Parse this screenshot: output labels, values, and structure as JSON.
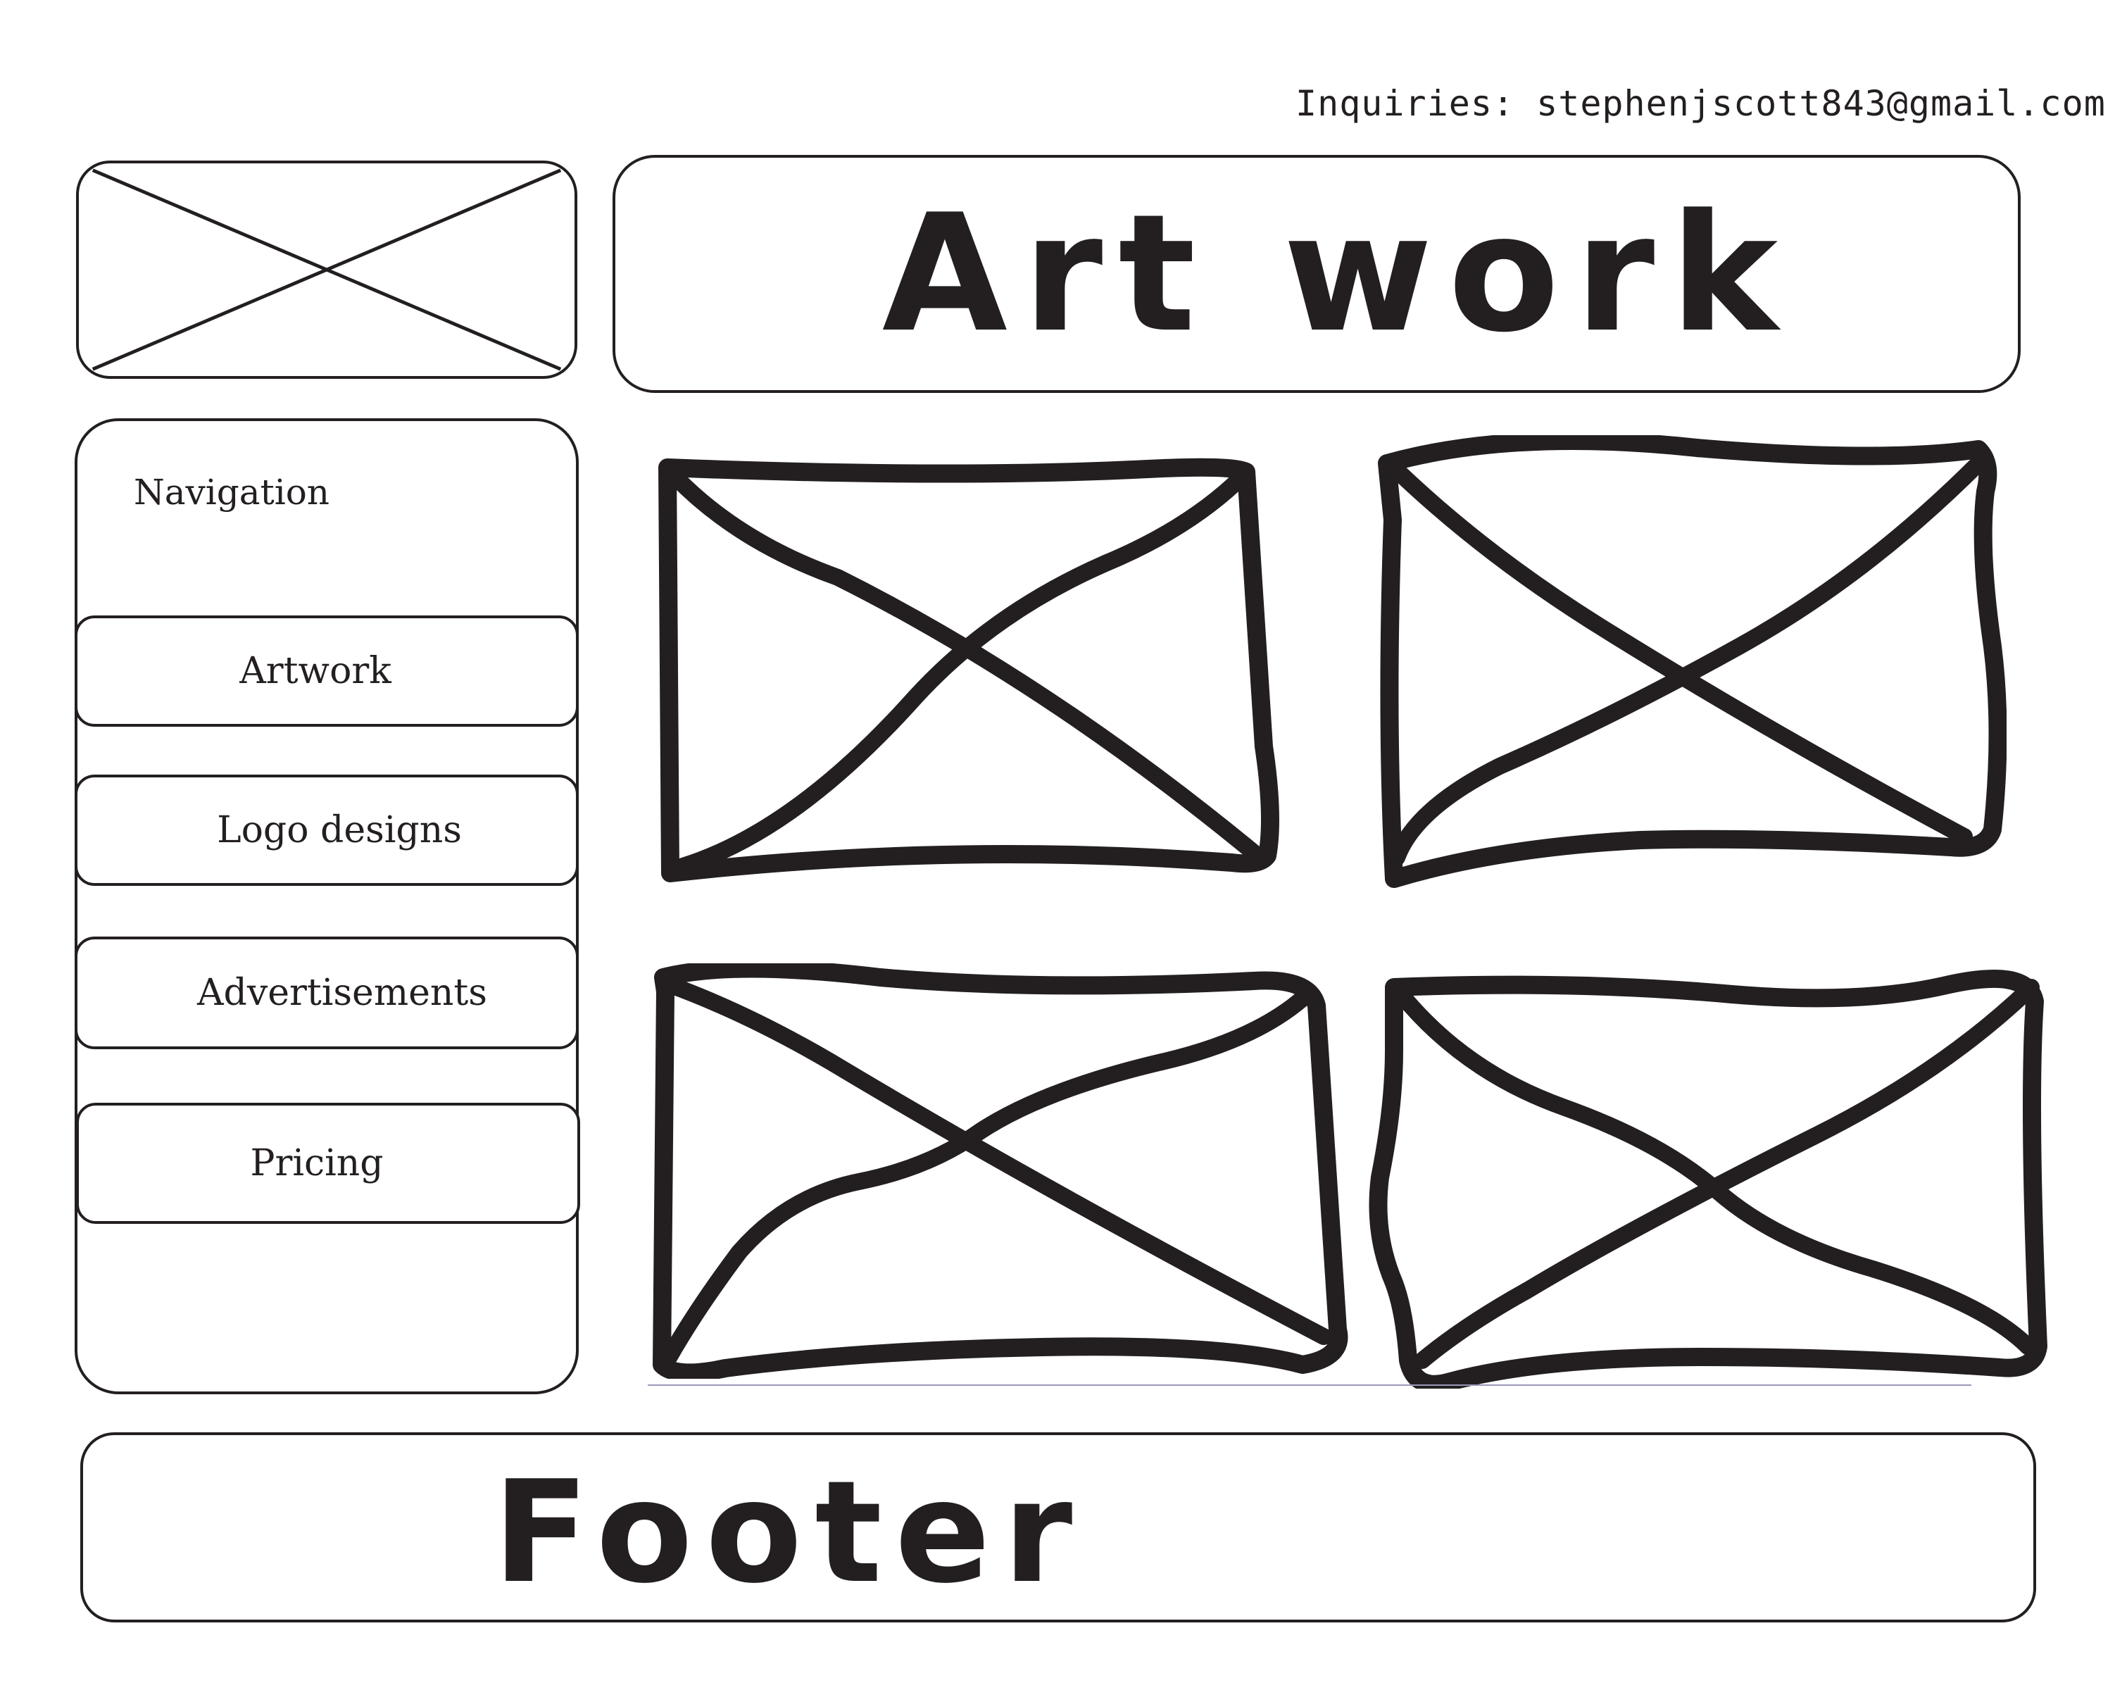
{
  "contact": {
    "inquiries": "Inquiries: stephenjscott843@gmail.com"
  },
  "logo": {
    "icon": "image-placeholder-icon"
  },
  "header": {
    "title": "Art work"
  },
  "navigation": {
    "heading": "Navigation",
    "items": [
      {
        "label": "Artwork"
      },
      {
        "label": "Logo designs"
      },
      {
        "label": "Advertisements"
      },
      {
        "label": "Pricing"
      }
    ]
  },
  "gallery": {
    "tile_icon": "image-placeholder-icon",
    "tile_count_visible": 4
  },
  "footer": {
    "title": "Footer"
  },
  "colors": {
    "ink": "#231f20",
    "background": "#ffffff"
  }
}
